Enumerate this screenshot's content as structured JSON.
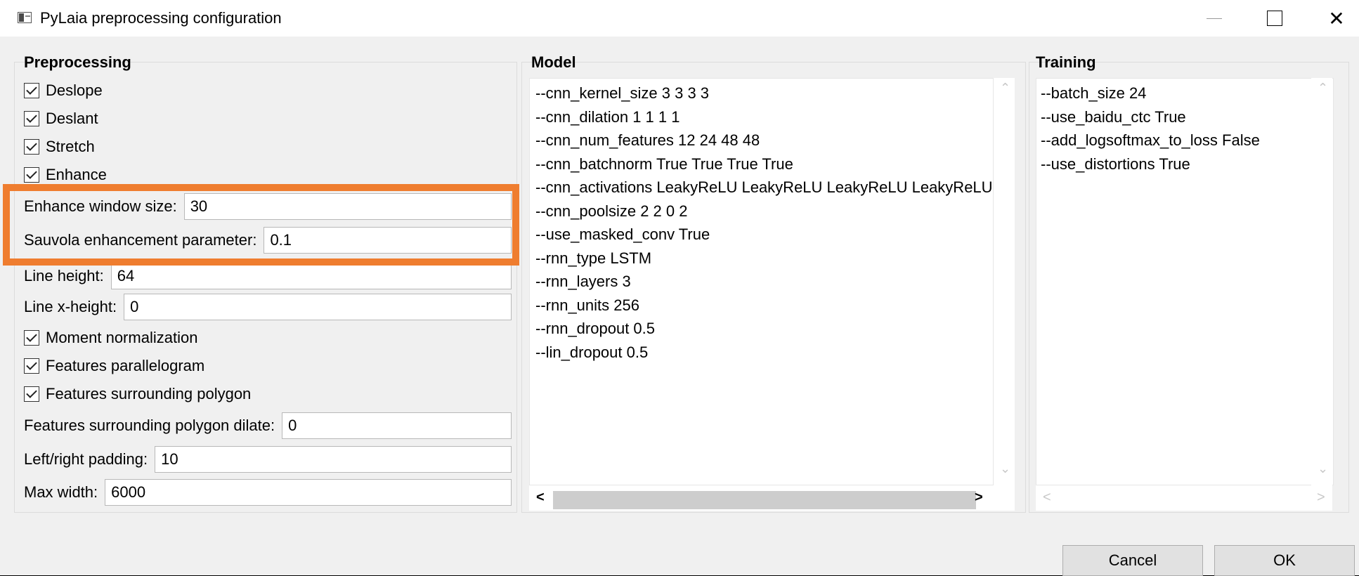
{
  "window": {
    "title": "PyLaia preprocessing configuration",
    "icon": "app-window-icon",
    "controls": {
      "minimize": "—",
      "maximize": "□",
      "close": "✕"
    }
  },
  "preprocessing": {
    "title": "Preprocessing",
    "checkboxes": [
      {
        "label": "Deslope",
        "checked": true
      },
      {
        "label": "Deslant",
        "checked": true
      },
      {
        "label": "Stretch",
        "checked": true
      },
      {
        "label": "Enhance",
        "checked": true
      }
    ],
    "enhance_window_size": {
      "label": "Enhance window size:",
      "value": "30"
    },
    "sauvola_parameter": {
      "label": "Sauvola enhancement parameter:",
      "value": "0.1"
    },
    "line_height": {
      "label": "Line height:",
      "value": "64"
    },
    "line_xheight": {
      "label": "Line x-height:",
      "value": "0"
    },
    "checkboxes2": [
      {
        "label": "Moment normalization",
        "checked": true
      },
      {
        "label": "Features parallelogram",
        "checked": true
      },
      {
        "label": "Features surrounding polygon",
        "checked": true
      }
    ],
    "polygon_dilate": {
      "label": "Features surrounding polygon dilate:",
      "value": "0"
    },
    "padding": {
      "label": "Left/right padding:",
      "value": "10"
    },
    "max_width": {
      "label": "Max width:",
      "value": "6000"
    }
  },
  "model": {
    "title": "Model",
    "lines": [
      "--cnn_kernel_size 3 3 3 3",
      "--cnn_dilation 1 1 1 1",
      "--cnn_num_features 12 24 48 48",
      "--cnn_batchnorm True True True True",
      "--cnn_activations LeakyReLU LeakyReLU LeakyReLU LeakyReLU",
      "--cnn_poolsize 2 2 0 2",
      "--use_masked_conv True",
      "--rnn_type LSTM",
      "--rnn_layers 3",
      "--rnn_units 256",
      "--rnn_dropout 0.5",
      "--lin_dropout 0.5"
    ]
  },
  "training": {
    "title": "Training",
    "lines": [
      "--batch_size 24",
      "--use_baidu_ctc True",
      "--add_logsoftmax_to_loss False",
      "--use_distortions True"
    ]
  },
  "scroll_arrows": {
    "up": "⌃",
    "down": "⌄",
    "left": "<",
    "right": ">"
  },
  "buttons": {
    "cancel": "Cancel",
    "ok": "OK"
  },
  "colors": {
    "highlight": "#ef7d2f",
    "background": "#f0f0f0"
  }
}
